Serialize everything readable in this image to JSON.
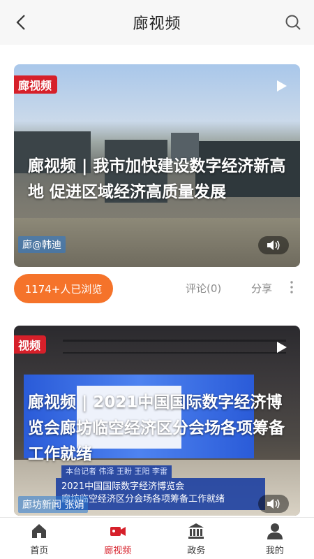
{
  "header": {
    "title": "廊视频"
  },
  "cards": [
    {
      "logo": "廊视频",
      "headline": "廊视频 | 我市加快建设数字经济新高地 促进区域经济高质量发展",
      "reporter": "廊@韩迪"
    },
    {
      "logo": "视频",
      "headline": "廊视频 | 2021中国国际数字经济博览会廊坊临空经济区分会场各项筹备工作就绪",
      "reporter": "廊坊新闻 张娟",
      "caption_small": "本台记者 伟泽 王盼 王阳 李雷",
      "caption_line1": "2021中国国际数字经济博览会",
      "caption_line2": "廊坊临空经济区分会场各项筹备工作就绪"
    }
  ],
  "meta": {
    "views": "1174+人已浏览",
    "comment": "评论(0)",
    "share": "分享"
  },
  "nav": [
    {
      "label": "首页",
      "icon": "home-icon"
    },
    {
      "label": "廊视频",
      "icon": "video-camera-icon"
    },
    {
      "label": "政务",
      "icon": "government-building-icon"
    },
    {
      "label": "我的",
      "icon": "user-icon"
    }
  ],
  "colors": {
    "accent": "#d6202a",
    "orange": "#f5732a"
  }
}
